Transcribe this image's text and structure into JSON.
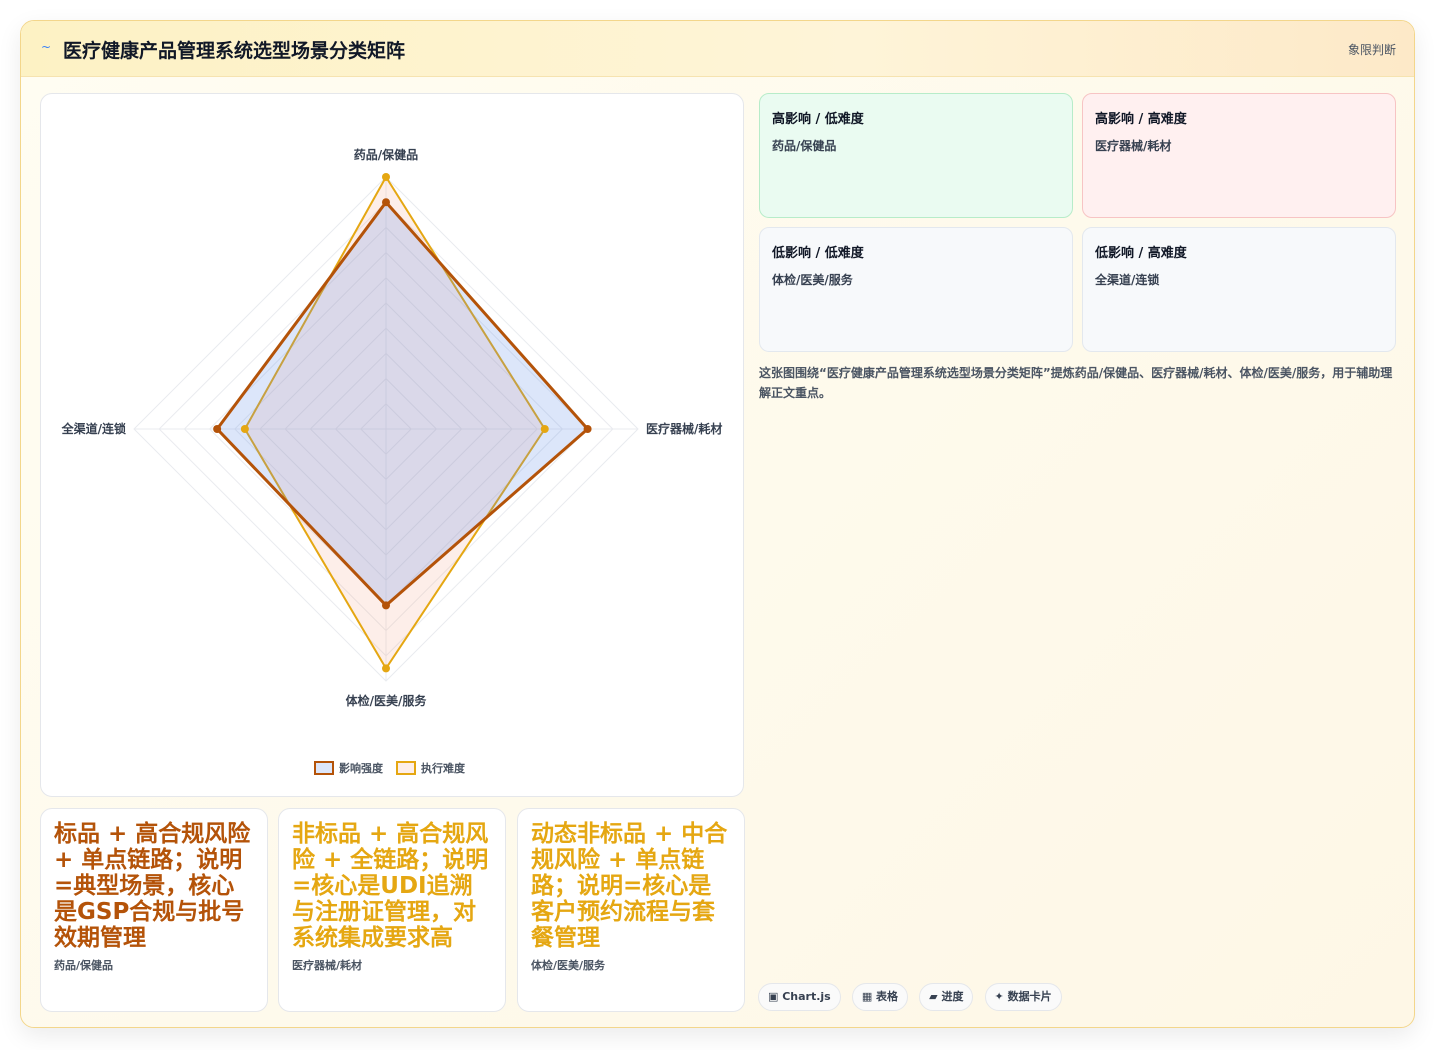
{
  "header": {
    "logo_icon": "~",
    "title": "医疗健康产品管理系统选型场景分类矩阵",
    "tag": "象限判断"
  },
  "chart_data": {
    "type": "radar",
    "categories": [
      "药品/保健品",
      "医疗器械/耗材",
      "体检/医美/服务",
      "全渠道/连锁"
    ],
    "series": [
      {
        "name": "影响强度",
        "values": [
          9,
          8,
          7,
          6.7
        ],
        "color": "#b45309"
      },
      {
        "name": "执行难度",
        "values": [
          10,
          6.3,
          9.5,
          5.6
        ],
        "color": "#e5a712"
      }
    ],
    "rmax": 10,
    "legend": "bottom"
  },
  "quadrants": [
    {
      "title": "高影响 / 低难度",
      "item": "药品/保健品"
    },
    {
      "title": "高影响 / 高难度",
      "item": "医疗器械/耗材"
    },
    {
      "title": "低影响 / 低难度",
      "item": "体检/医美/服务"
    },
    {
      "title": "低影响 / 高难度",
      "item": "全渠道/连锁"
    }
  ],
  "description": "这张图围绕“医疗健康产品管理系统选型场景分类矩阵”提炼药品/保健品、医疗器械/耗材、体检/医美/服务，用于辅助理解正文重点。",
  "stat_cards": [
    {
      "text": "标品 + 高合规风险 + 单点链路；说明=典型场景，核心是GSP合规与批号效期管理",
      "label": "药品/保健品",
      "color": "#b45309"
    },
    {
      "text": "非标品 + 高合规风险 + 全链路；说明=核心是UDI追溯与注册证管理，对系统集成要求高",
      "label": "医疗器械/耗材",
      "color": "#e5a712"
    },
    {
      "text": "动态非标品 + 中合规风险 + 单点链路；说明=核心是客户预约流程与套餐管理",
      "label": "体检/医美/服务",
      "color": "#e5a712"
    }
  ],
  "chips": [
    "▣ Chart.js",
    "▦ 表格",
    "▰ 进度",
    "✦ 数据卡片"
  ]
}
